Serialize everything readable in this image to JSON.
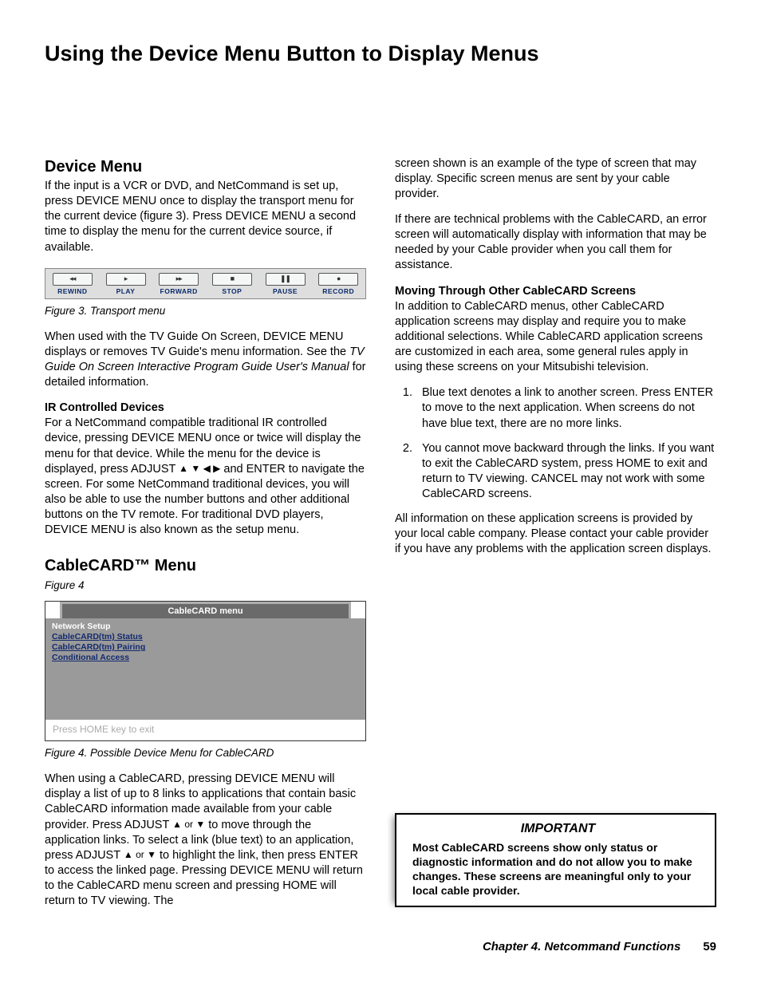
{
  "title": "Using the Device Menu Button to Display Menus",
  "left": {
    "h_device_menu": "Device Menu",
    "p_device_intro": "If the input is a VCR or DVD, and NetCommand is set up, press DEVICE MENU once to display the transport menu for the current device (figure 3).  Press DEVICE MENU a second time to display the menu for the current device source, if available.",
    "transport": {
      "items": [
        {
          "glyph": "◂◂",
          "label": "REWIND"
        },
        {
          "glyph": "▸",
          "label": "PLAY"
        },
        {
          "glyph": "▸▸",
          "label": "FORWARD"
        },
        {
          "glyph": "■",
          "label": "STOP"
        },
        {
          "glyph": "❚❚",
          "label": "PAUSE"
        },
        {
          "glyph": "●",
          "label": "RECORD"
        }
      ]
    },
    "cap_fig3": "Figure 3. Transport menu",
    "p_tvguide_a": "When used with the TV Guide On Screen, DEVICE MENU displays or removes TV Guide's menu information.  See the ",
    "p_tvguide_b": "TV Guide On Screen Interactive Program Guide User's Manual",
    "p_tvguide_c": " for detailed information.",
    "sub_ir": "IR Controlled Devices",
    "p_ir_a": "For a NetCommand compatible traditional IR controlled device, pressing DEVICE MENU once or twice will display the menu for that device.  While the menu for the device is displayed, press ADJUST ",
    "p_ir_arrows": "▲ ▼ ◀ ▶",
    "p_ir_b": " and ENTER to navigate the screen.  For some NetCommand traditional devices, you will also be able to use the number buttons and other additional buttons on the TV remote.  For traditional DVD players, DEVICE MENU is also known as the setup menu.",
    "h_cablecard": "CableCARD™ Menu",
    "cap_fig4_top": "Figure 4",
    "cablecard": {
      "title": "CableCARD menu",
      "items": {
        "ns": "Network Setup",
        "l1": "CableCARD(tm) Status",
        "l2": "CableCARD(tm) Pairing",
        "l3": "Conditional Access"
      },
      "exit": "Press HOME key to exit"
    },
    "cap_fig4_bottom": "Figure 4. Possible Device Menu for CableCARD",
    "p_cablecard_a": "When using a CableCARD, pressing DEVICE MENU will display a list of up to 8 links to applications that contain basic CableCARD information made available from your cable provider.  Press ADJUST ",
    "p_cablecard_arrows1": "▲ or ▼",
    "p_cablecard_b": " to move through the application links.  To select a link (blue text) to an application, press ADJUST ",
    "p_cablecard_arrows2": "▲ or ▼",
    "p_cablecard_c": " to highlight the link, then press ENTER to access the linked page.  Pressing DEVICE MENU will return to the CableCARD menu screen and pressing HOME will return to TV viewing.  The"
  },
  "right": {
    "p_contd": "screen shown is an example of the type of screen that may display.  Specific screen menus are sent by your cable provider.",
    "p_error": "If there are technical problems with the CableCARD, an error screen will automatically display with information that may be needed by your Cable provider when you call them for assistance.",
    "sub_moving": "Moving Through Other CableCARD Screens",
    "p_moving": "In addition to CableCARD menus, other CableCARD application screens may display and require you to make additional selections.  While CableCARD application screens are customized in each area, some general rules apply in using these screens on your Mitsubishi television.",
    "ol": {
      "i1": "Blue text denotes a link to another screen. Press ENTER to move to the next application. When screens do not have blue text, there are no more links.",
      "i2": "You cannot move backward through the links.  If you want to exit the CableCARD system, press HOME to exit and return to TV viewing.  CANCEL may not work with some CableCARD screens."
    },
    "p_allinfo": "All information on these application screens is provided by your local cable company.  Please contact your cable provider if you have any problems with the application screen displays.",
    "important": {
      "title": "IMPORTANT",
      "body": "Most CableCARD screens show only status or diagnostic information and do not allow you to make changes.  These screens are meaningful only to your local cable provider."
    }
  },
  "footer": {
    "chapter": "Chapter 4. Netcommand Functions",
    "page": "59"
  }
}
